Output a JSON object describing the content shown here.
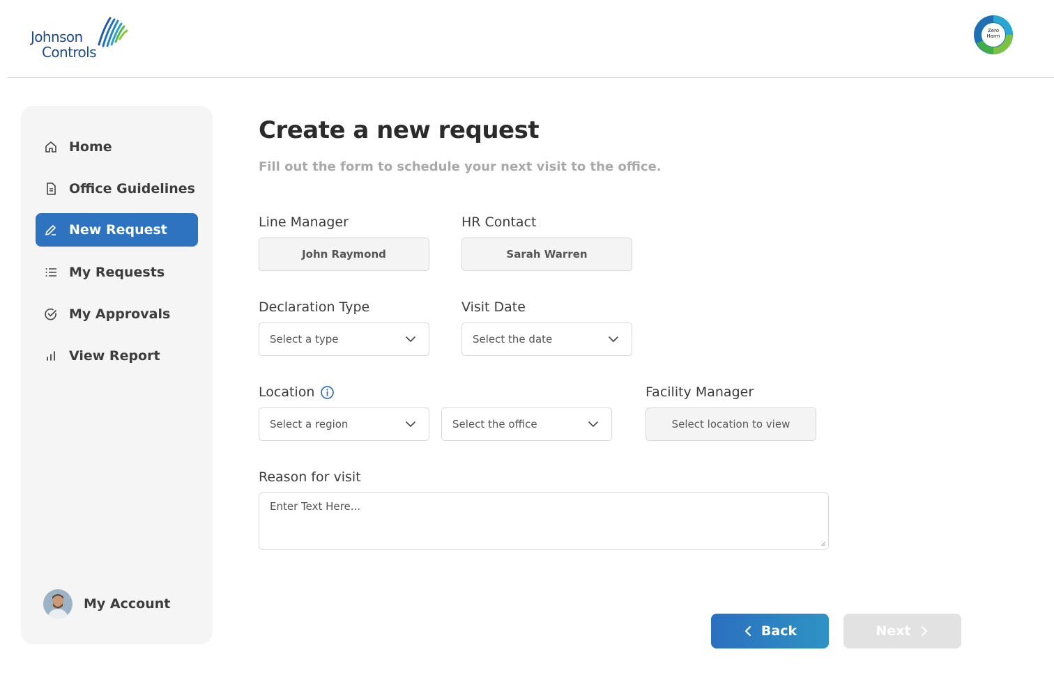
{
  "header": {
    "logo": {
      "line1": "Johnson",
      "line2": "Controls"
    },
    "badge": {
      "line1": "Zero",
      "line2": "Harm"
    }
  },
  "sidebar": {
    "items": [
      {
        "label": "Home",
        "icon": "home-icon"
      },
      {
        "label": "Office Guidelines",
        "icon": "document-icon"
      },
      {
        "label": "New Request",
        "icon": "pencil-icon",
        "active": true
      },
      {
        "label": "My Requests",
        "icon": "list-icon"
      },
      {
        "label": "My Approvals",
        "icon": "check-circle-icon"
      },
      {
        "label": "View Report",
        "icon": "bar-chart-icon"
      }
    ],
    "account_label": "My Account"
  },
  "main": {
    "title": "Create a new request",
    "subtitle": "Fill out the form to schedule your next visit to the office.",
    "line_manager": {
      "label": "Line Manager",
      "value": "John Raymond"
    },
    "hr_contact": {
      "label": "HR Contact",
      "value": "Sarah Warren"
    },
    "declaration_type": {
      "label": "Declaration Type",
      "value": "Select a type"
    },
    "visit_date": {
      "label": "Visit Date",
      "value": "Select the date"
    },
    "location": {
      "label": "Location",
      "region_value": "Select a region",
      "office_value": "Select the office"
    },
    "facility_manager": {
      "label": "Facility Manager",
      "value": "Select location to view"
    },
    "reason": {
      "label": "Reason for visit",
      "placeholder": "Enter Text Here..."
    },
    "buttons": {
      "back": "Back",
      "next": "Next"
    }
  },
  "colors": {
    "accent": "#2d73c0",
    "sidebar_bg": "#f5f5f5",
    "disabled": "#e2e2e2",
    "subtitle": "#a9a9a9"
  }
}
